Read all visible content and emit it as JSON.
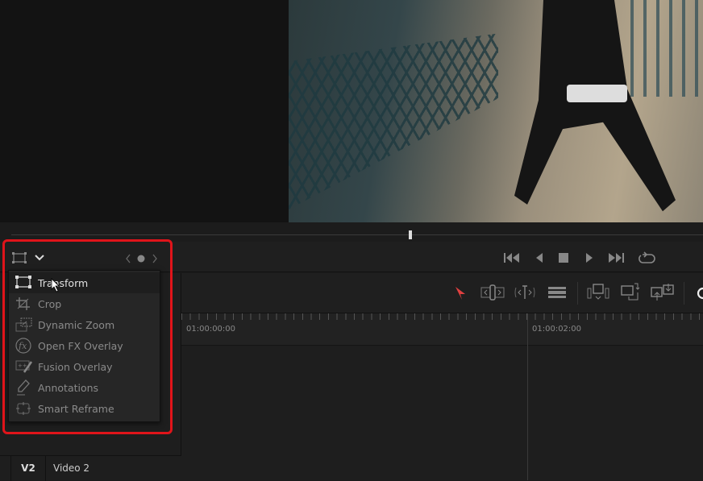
{
  "viewer": {
    "timecodes": [
      "01:00:00:00",
      "01:00:02:00"
    ]
  },
  "overlay_menu": {
    "items": [
      {
        "label": "Transform",
        "icon": "transform-icon",
        "active": true
      },
      {
        "label": "Crop",
        "icon": "crop-icon"
      },
      {
        "label": "Dynamic Zoom",
        "icon": "dynamic-zoom-icon"
      },
      {
        "label": "Open FX Overlay",
        "icon": "fx-icon"
      },
      {
        "label": "Fusion Overlay",
        "icon": "fusion-overlay-icon"
      },
      {
        "label": "Annotations",
        "icon": "annotation-pen-icon"
      },
      {
        "label": "Smart Reframe",
        "icon": "smart-reframe-icon"
      }
    ]
  },
  "timeline": {
    "track": {
      "id": "V2",
      "name": "Video 2"
    }
  },
  "colors": {
    "highlight": "#e0141a",
    "selection_tool": "#e04040"
  }
}
